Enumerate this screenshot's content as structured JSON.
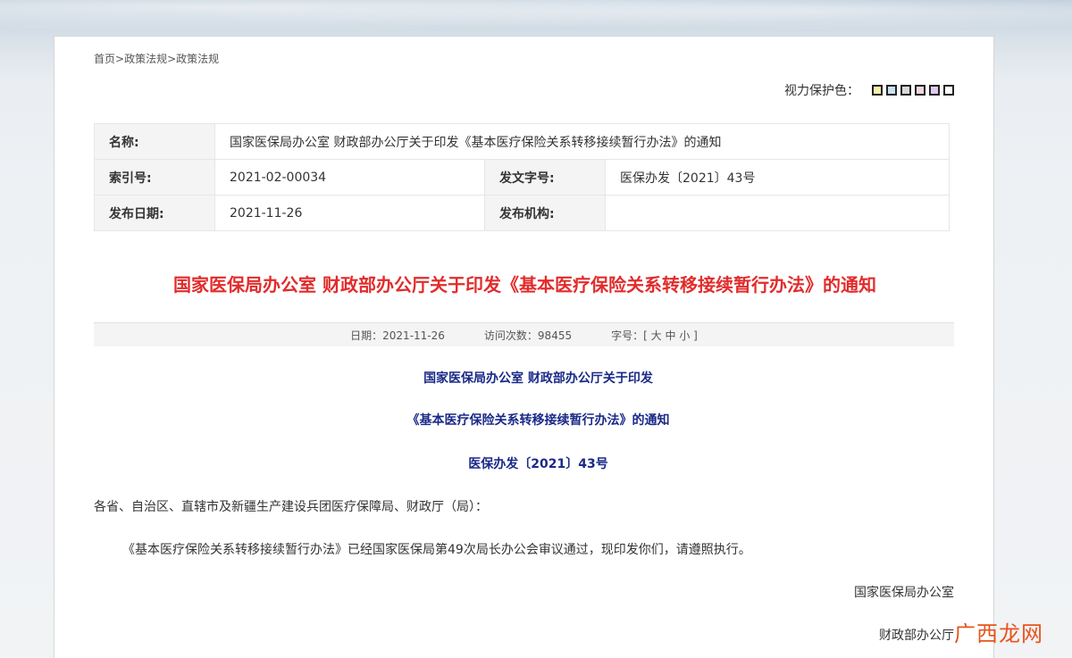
{
  "breadcrumb": {
    "home": "首页",
    "sep1": ">",
    "level1": "政策法规",
    "sep2": ">",
    "level2": "政策法规"
  },
  "eye_care": {
    "label": "视力保护色：",
    "swatches": [
      "#f3f0a8",
      "#c8e2f2",
      "#d8d8d8",
      "#f2d6de",
      "#e1c9f0",
      "#ffffff"
    ]
  },
  "meta": {
    "name_key": "名称:",
    "name_val": "国家医保局办公室 财政部办公厅关于印发《基本医疗保险关系转移接续暂行办法》的通知",
    "index_key": "索引号:",
    "index_val": "2021-02-00034",
    "docno_key": "发文字号:",
    "docno_val": "医保办发〔2021〕43号",
    "date_key": "发布日期:",
    "date_val": "2021-11-26",
    "org_key": "发布机构:",
    "org_val": ""
  },
  "title": "国家医保局办公室 财政部办公厅关于印发《基本医疗保险关系转移接续暂行办法》的通知",
  "info": {
    "date_label": "日期：",
    "date_val": "2021-11-26",
    "visits_label": "访问次数：",
    "visits_val": "98455",
    "font_label": "字号：[",
    "font_large": "大",
    "font_mid": "中",
    "font_small": "小",
    "font_end": "]"
  },
  "doc": {
    "heading1": "国家医保局办公室  财政部办公厅关于印发",
    "heading2": "《基本医疗保险关系转移接续暂行办法》的通知",
    "heading3": "医保办发〔2021〕43号",
    "salutation": "各省、自治区、直辖市及新疆生产建设兵团医疗保障局、财政厅（局）：",
    "body": "《基本医疗保险关系转移接续暂行办法》已经国家医保局第49次局长办公会审议通过，现印发你们，请遵照执行。",
    "sign1": "国家医保局办公室",
    "sign2": "财政部办公厅"
  },
  "watermark": "广西龙网"
}
